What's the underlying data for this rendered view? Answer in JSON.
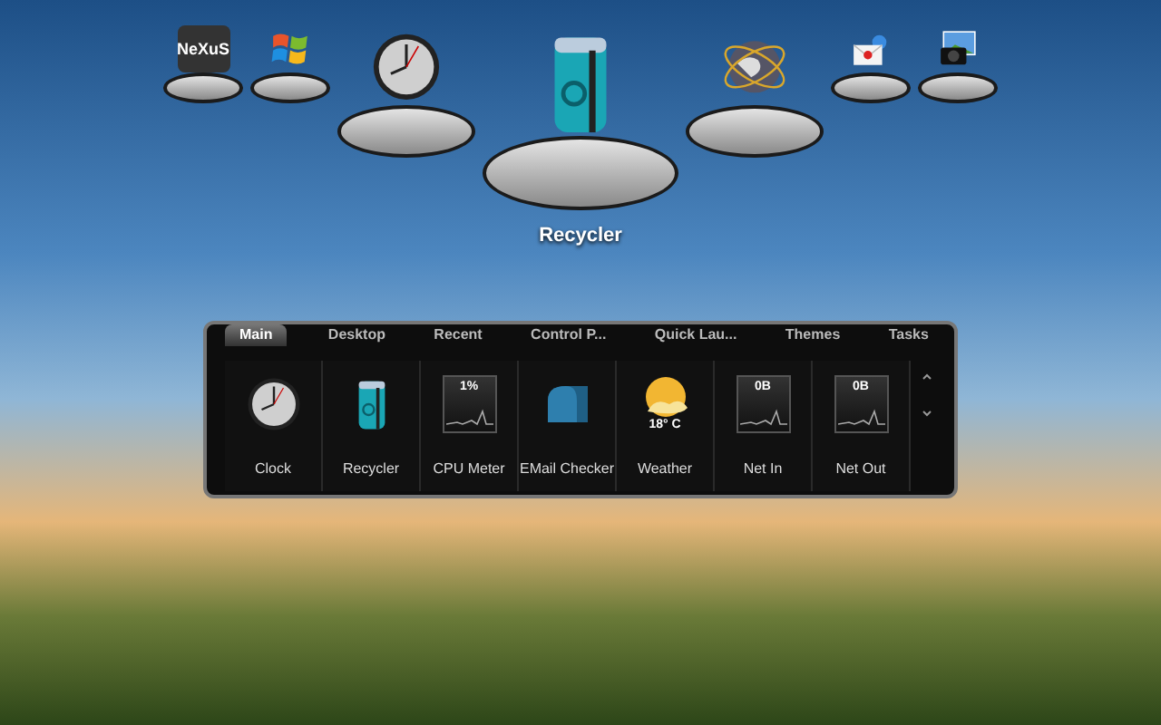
{
  "dock": {
    "items": [
      {
        "kind": "nexus",
        "logo_text": "NeXuS",
        "selected": false
      },
      {
        "kind": "windows",
        "selected": false
      },
      {
        "kind": "clock",
        "selected": false
      },
      {
        "kind": "recycler",
        "label": "Recycler",
        "selected": true
      },
      {
        "kind": "globe",
        "selected": false
      },
      {
        "kind": "mail",
        "selected": false
      },
      {
        "kind": "camera",
        "selected": false
      }
    ]
  },
  "widget_panel": {
    "tabs": [
      {
        "label": "Main",
        "selected": true
      },
      {
        "label": "Desktop",
        "selected": false
      },
      {
        "label": "Recent",
        "selected": false
      },
      {
        "label": "Control P...",
        "selected": false
      },
      {
        "label": "Quick Lau...",
        "selected": false
      },
      {
        "label": "Themes",
        "selected": false
      },
      {
        "label": "Tasks",
        "selected": false
      }
    ],
    "widgets": [
      {
        "kind": "clock",
        "label": "Clock"
      },
      {
        "kind": "recycler",
        "label": "Recycler"
      },
      {
        "kind": "meter",
        "label": "CPU Meter",
        "reading": "1%"
      },
      {
        "kind": "mailbox",
        "label": "EMail Checker"
      },
      {
        "kind": "weather",
        "label": "Weather",
        "reading": "18° C"
      },
      {
        "kind": "meter",
        "label": "Net In",
        "reading": "0B"
      },
      {
        "kind": "meter",
        "label": "Net Out",
        "reading": "0B"
      }
    ]
  }
}
